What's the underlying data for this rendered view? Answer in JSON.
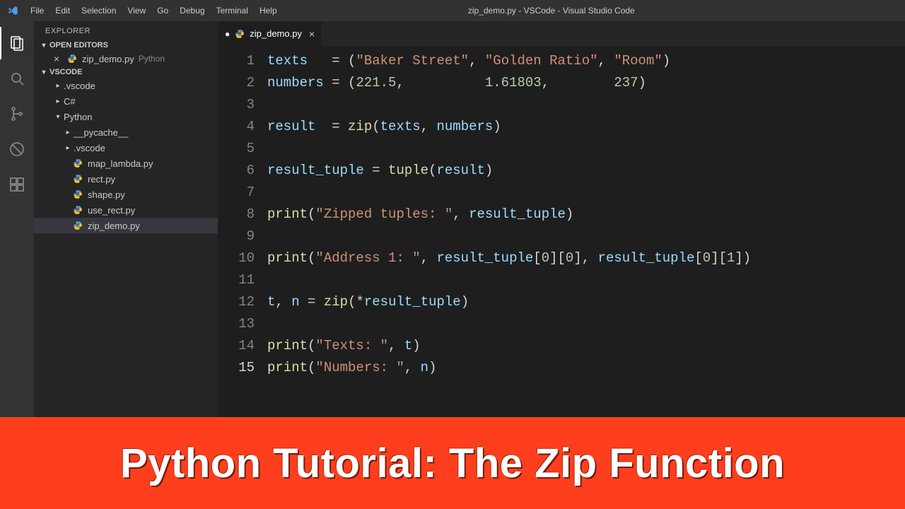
{
  "window": {
    "title": "zip_demo.py - VSCode - Visual Studio Code"
  },
  "menu": [
    "File",
    "Edit",
    "Selection",
    "View",
    "Go",
    "Debug",
    "Terminal",
    "Help"
  ],
  "activity": [
    "files",
    "search",
    "git",
    "debug",
    "extensions"
  ],
  "explorer": {
    "title": "Explorer",
    "open_editors_label": "Open Editors",
    "open_editors": [
      {
        "name": "zip_demo.py",
        "lang": "Python"
      }
    ],
    "workspace_label": "VSCode",
    "tree": [
      {
        "type": "folder",
        "name": ".vscode",
        "depth": 2,
        "expanded": false
      },
      {
        "type": "folder",
        "name": "C#",
        "depth": 2,
        "expanded": false
      },
      {
        "type": "folder",
        "name": "Python",
        "depth": 2,
        "expanded": true
      },
      {
        "type": "folder",
        "name": "__pycache__",
        "depth": 3,
        "expanded": false
      },
      {
        "type": "folder",
        "name": ".vscode",
        "depth": 3,
        "expanded": false
      },
      {
        "type": "file",
        "name": "map_lambda.py",
        "depth": 3
      },
      {
        "type": "file",
        "name": "rect.py",
        "depth": 3
      },
      {
        "type": "file",
        "name": "shape.py",
        "depth": 3
      },
      {
        "type": "file",
        "name": "use_rect.py",
        "depth": 3
      },
      {
        "type": "file",
        "name": "zip_demo.py",
        "depth": 3,
        "selected": true
      }
    ]
  },
  "tab": {
    "name": "zip_demo.py",
    "modified": true
  },
  "code": {
    "active_line": 15,
    "lines": [
      [
        [
          "ident",
          "texts   "
        ],
        [
          "white",
          "= ("
        ],
        [
          "str",
          "\"Baker Street\""
        ],
        [
          "white",
          ", "
        ],
        [
          "str",
          "\"Golden Ratio\""
        ],
        [
          "white",
          ", "
        ],
        [
          "str",
          "\"Room\""
        ],
        [
          "white",
          ")"
        ]
      ],
      [
        [
          "ident",
          "numbers "
        ],
        [
          "white",
          "= ("
        ],
        [
          "num",
          "221.5"
        ],
        [
          "white",
          ",          "
        ],
        [
          "num",
          "1.61803"
        ],
        [
          "white",
          ",        "
        ],
        [
          "num",
          "237"
        ],
        [
          "white",
          ")"
        ]
      ],
      [],
      [
        [
          "ident",
          "result  "
        ],
        [
          "white",
          "= "
        ],
        [
          "fn",
          "zip"
        ],
        [
          "white",
          "("
        ],
        [
          "ident",
          "texts"
        ],
        [
          "white",
          ", "
        ],
        [
          "ident",
          "numbers"
        ],
        [
          "white",
          ")"
        ]
      ],
      [],
      [
        [
          "ident",
          "result_tuple "
        ],
        [
          "white",
          "= "
        ],
        [
          "fn",
          "tuple"
        ],
        [
          "white",
          "("
        ],
        [
          "ident",
          "result"
        ],
        [
          "white",
          ")"
        ]
      ],
      [],
      [
        [
          "fn",
          "print"
        ],
        [
          "white",
          "("
        ],
        [
          "str",
          "\"Zipped tuples: \""
        ],
        [
          "white",
          ", "
        ],
        [
          "ident",
          "result_tuple"
        ],
        [
          "white",
          ")"
        ]
      ],
      [],
      [
        [
          "fn",
          "print"
        ],
        [
          "white",
          "("
        ],
        [
          "str",
          "\"Address 1: \""
        ],
        [
          "white",
          ", "
        ],
        [
          "ident",
          "result_tuple"
        ],
        [
          "white",
          "["
        ],
        [
          "num",
          "0"
        ],
        [
          "white",
          "]["
        ],
        [
          "num",
          "0"
        ],
        [
          "white",
          "], "
        ],
        [
          "ident",
          "result_tuple"
        ],
        [
          "white",
          "["
        ],
        [
          "num",
          "0"
        ],
        [
          "white",
          "]["
        ],
        [
          "num",
          "1"
        ],
        [
          "white",
          "])"
        ]
      ],
      [],
      [
        [
          "ident",
          "t"
        ],
        [
          "white",
          ", "
        ],
        [
          "ident",
          "n "
        ],
        [
          "white",
          "= "
        ],
        [
          "fn",
          "zip"
        ],
        [
          "white",
          "(*"
        ],
        [
          "ident",
          "result_tuple"
        ],
        [
          "white",
          ")"
        ]
      ],
      [],
      [
        [
          "fn",
          "print"
        ],
        [
          "white",
          "("
        ],
        [
          "str",
          "\"Texts: \""
        ],
        [
          "white",
          ", "
        ],
        [
          "ident",
          "t"
        ],
        [
          "white",
          ")"
        ]
      ],
      [
        [
          "fn",
          "print"
        ],
        [
          "white",
          "("
        ],
        [
          "str",
          "\"Numbers: \""
        ],
        [
          "white",
          ", "
        ],
        [
          "ident",
          "n"
        ],
        [
          "white",
          ")"
        ]
      ]
    ]
  },
  "banner": {
    "text": "Python Tutorial: The Zip Function"
  },
  "icons": {
    "py_fill_top": "#4e8fd6",
    "py_fill_bot": "#f5c23b"
  }
}
